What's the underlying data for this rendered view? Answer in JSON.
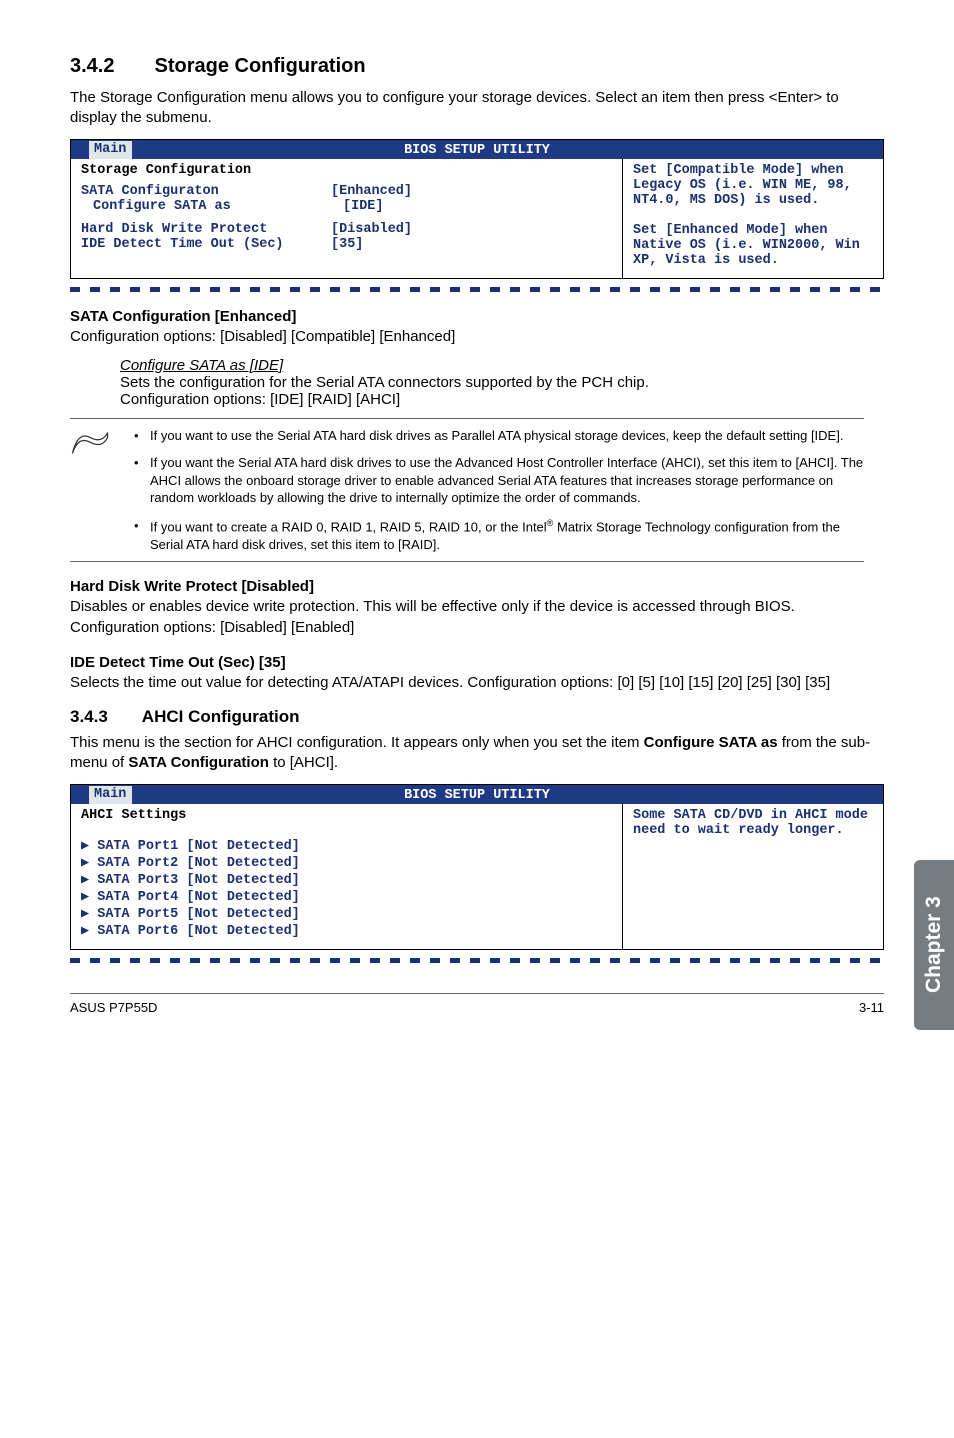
{
  "section1": {
    "heading": "3.4.2  Storage Configuration",
    "intro": "The Storage Configuration menu allows you to configure your storage devices. Select an item then press <Enter> to display the submenu."
  },
  "bios1": {
    "title": "BIOS SETUP UTILITY",
    "tab": "Main",
    "left_title": "Storage Configuration",
    "row1_label": "SATA Configuraton",
    "row1_value": "[Enhanced]",
    "row2_label": "Configure SATA as",
    "row2_value": "[IDE]",
    "row3_label": "Hard Disk Write Protect",
    "row3_value": "[Disabled]",
    "row4_label": "IDE Detect Time Out (Sec)",
    "row4_value": "[35]",
    "help": "Set [Compatible Mode] when Legacy OS (i.e. WIN ME, 98, NT4.0, MS DOS) is used.\n\nSet [Enhanced Mode] when Native OS (i.e. WIN2000, Win XP, Vista is used."
  },
  "sata_conf": {
    "heading": "SATA Configuration [Enhanced]",
    "text": "Configuration options: [Disabled] [Compatible] [Enhanced]"
  },
  "conf_sata_as": {
    "heading": "Configure SATA as [IDE]",
    "line1": "Sets the configuration for the Serial ATA connectors supported by the PCH chip.",
    "line2": "Configuration options: [IDE] [RAID] [AHCI]"
  },
  "notes": {
    "item1": "If you want to use the Serial ATA hard disk drives as Parallel ATA physical storage devices, keep the default setting [IDE].",
    "item2": "If you want the Serial ATA hard disk drives to use the Advanced Host Controller Interface (AHCI), set this item to [AHCI]. The AHCI allows the onboard storage driver to enable advanced Serial ATA features that increases storage performance on random workloads by allowing the drive to internally optimize the order of commands.",
    "item3_a": "If you want to create a RAID 0, RAID 1, RAID 5, RAID 10, or the Intel",
    "item3_b": " Matrix Storage Technology configuration from the Serial ATA hard disk drives, set this item to [RAID]."
  },
  "hdwp": {
    "heading": "Hard Disk Write Protect [Disabled]",
    "text": "Disables or enables device write protection. This will be effective only if the device is accessed through BIOS. Configuration options: [Disabled] [Enabled]"
  },
  "ide_to": {
    "heading": "IDE Detect Time Out (Sec) [35]",
    "text": "Selects the time out value for detecting ATA/ATAPI devices. Configuration options: [0] [5] [10] [15] [20] [25] [30] [35]"
  },
  "section2": {
    "heading": "3.4.3  AHCI Configuration",
    "intro_a": "This menu is the section for AHCI configuration. It appears only when you set the item ",
    "intro_b": "Configure SATA as",
    "intro_c": " from the sub-menu of ",
    "intro_d": "SATA Configuration",
    "intro_e": " to [AHCI]."
  },
  "bios2": {
    "title": "BIOS SETUP UTILITY",
    "tab": "Main",
    "left_title": "AHCI Settings",
    "port1": "SATA Port1 [Not Detected]",
    "port2": "SATA Port2 [Not Detected]",
    "port3": "SATA Port3 [Not Detected]",
    "port4": "SATA Port4 [Not Detected]",
    "port5": "SATA Port5 [Not Detected]",
    "port6": "SATA Port6 [Not Detected]",
    "help": "Some SATA CD/DVD in AHCI mode need to wait ready longer."
  },
  "side_tab": "Chapter 3",
  "footer": {
    "left": "ASUS P7P55D",
    "right": "3-11"
  }
}
